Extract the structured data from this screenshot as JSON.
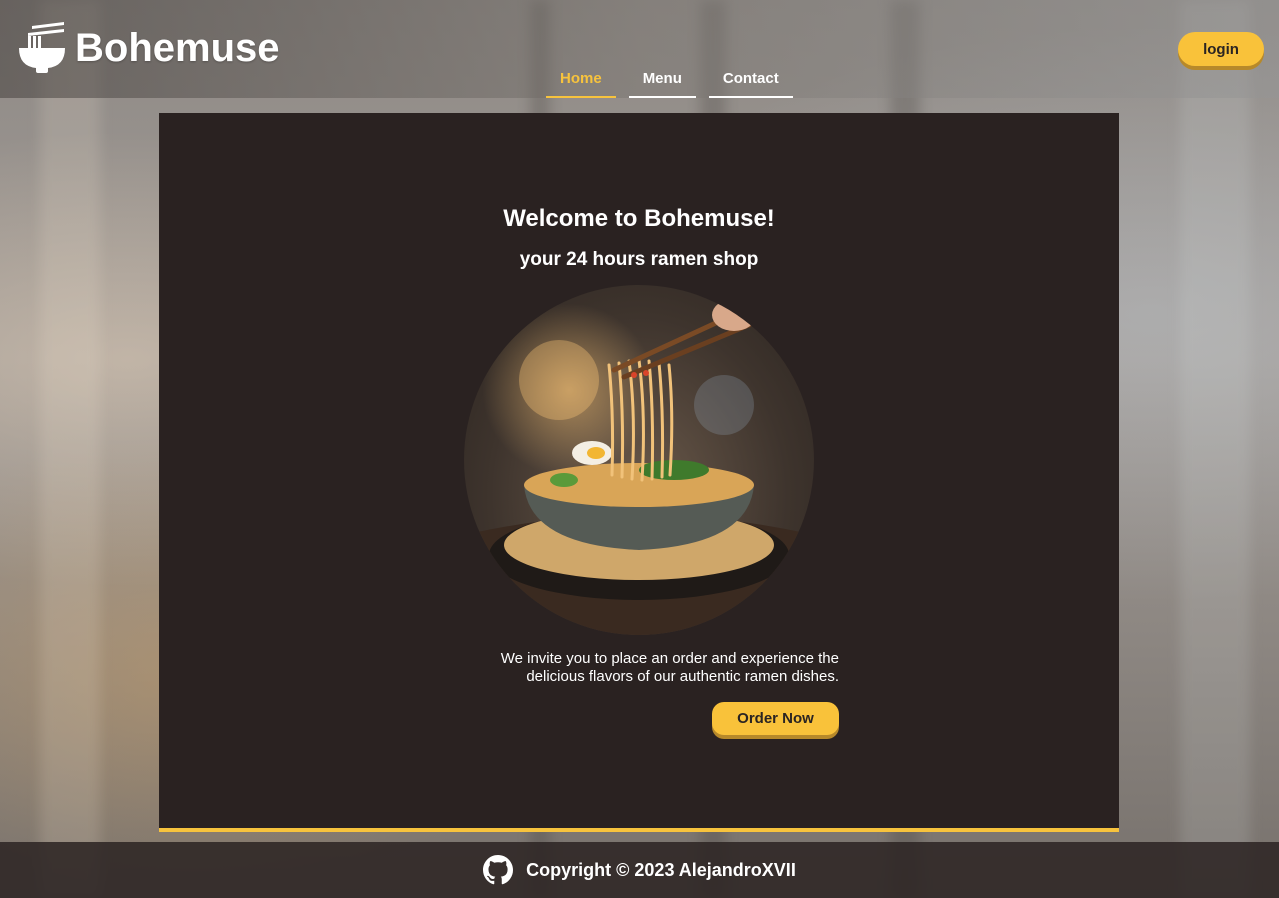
{
  "header": {
    "brand": {
      "name": "Bohemuse",
      "icon": "ramen-bowl-icon"
    },
    "nav": [
      {
        "label": "Home",
        "active": true
      },
      {
        "label": "Menu",
        "active": false
      },
      {
        "label": "Contact",
        "active": false
      }
    ],
    "login_label": "login"
  },
  "main": {
    "title": "Welcome to Bohemuse!",
    "subtitle": "your 24 hours ramen shop",
    "image": "ramen-bowl-photo",
    "invite_text": "We invite you to place an order and experience the delicious flavors of our authentic ramen dishes.",
    "order_label": "Order Now"
  },
  "footer": {
    "icon": "github-icon",
    "copyright": "Copyright © 2023 AlejandroXVII"
  },
  "colors": {
    "accent": "#f7c33d",
    "panel": "#2a2221",
    "text": "#ffffff"
  }
}
